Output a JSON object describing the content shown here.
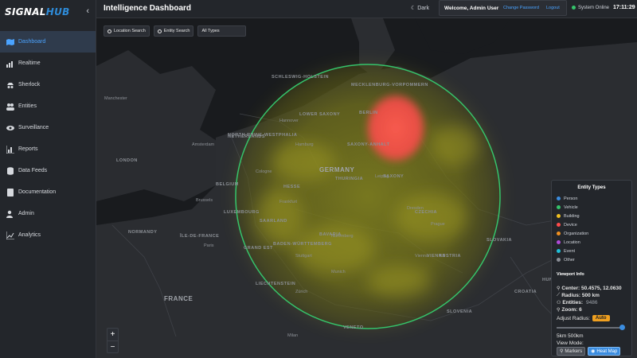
{
  "brand": {
    "name_part1": "SIGNAL",
    "name_part2": "HUB",
    "accent_color": "#2e8bd8",
    "collapse_icon": "chevron-left-icon"
  },
  "sidebar": {
    "items": [
      {
        "label": "Dashboard",
        "icon": "map-icon",
        "active": true
      },
      {
        "label": "Realtime",
        "icon": "signal-icon"
      },
      {
        "label": "Sherlock",
        "icon": "detective-icon"
      },
      {
        "label": "Entities",
        "icon": "users-icon"
      },
      {
        "label": "Surveillance",
        "icon": "eye-icon"
      },
      {
        "label": "Reports",
        "icon": "chart-icon"
      },
      {
        "label": "Data Feeds",
        "icon": "database-icon"
      },
      {
        "label": "Documentation",
        "icon": "book-icon"
      },
      {
        "label": "Admin",
        "icon": "user-cog-icon"
      },
      {
        "label": "Analytics",
        "icon": "line-chart-icon"
      }
    ]
  },
  "header": {
    "title": "Intelligence Dashboard",
    "theme_label": "Dark",
    "welcome": "Welcome, Admin User",
    "change_password": "Change Password",
    "logout": "Logout",
    "status": "System Online",
    "time": "17:11:29"
  },
  "map": {
    "location_search": "Location Search",
    "entity_search": "Entity Search",
    "type_filter": "All Types",
    "zoom_in": "+",
    "zoom_out": "−",
    "labels": [
      "LONDON",
      "BELGIUM",
      "LUXEMBOURG",
      "GERMANY",
      "HESSE",
      "THURINGIA",
      "SAXONY",
      "BAVARIA",
      "CZECHIA",
      "AUSTRIA",
      "SLOVAKIA",
      "LOWER SAXONY",
      "SAXONY-ANHALT",
      "MECKLENBURG-VORPOMMERN",
      "SCHLESWIG-HOLSTEIN",
      "NORTH RHINE-WESTPHALIA",
      "SAARLAND",
      "BADEN-WÜRTTEMBERG",
      "LIECHTENSTEIN",
      "NETHERLANDS",
      "NORMANDY",
      "ÎLE-DE-FRANCE",
      "GRAND EST",
      "FRANCE",
      "VENETO",
      "SLOVENIA",
      "CROATIA",
      "HUNGARY",
      "VIENNA",
      "BERLIN",
      "Hamburg",
      "Hannover",
      "Leipzig",
      "Dresden",
      "Nuremberg",
      "Munich",
      "Vienna",
      "Prague",
      "Paris",
      "Brussels",
      "Amsterdam",
      "Frankfurt",
      "Cologne",
      "Stuttgart",
      "Zürich",
      "Milan",
      "Manchester"
    ],
    "heat": {
      "circle_color": "#35c46b",
      "glow_color": "#c9c21f",
      "hotspot_color": "#ff4b4b"
    }
  },
  "panel": {
    "title": "Entity Types",
    "legend": [
      {
        "label": "Person",
        "color": "#3b8de0"
      },
      {
        "label": "Vehicle",
        "color": "#35c46b"
      },
      {
        "label": "Building",
        "color": "#f0c020"
      },
      {
        "label": "Device",
        "color": "#ff4b4b"
      },
      {
        "label": "Organization",
        "color": "#f09020"
      },
      {
        "label": "Location",
        "color": "#b04bd8"
      },
      {
        "label": "Event",
        "color": "#20c0d8"
      },
      {
        "label": "Other",
        "color": "#8a8e96"
      }
    ],
    "viewport_title": "Viewport Info",
    "center": "Center: 50.4575, 12.0630",
    "radius": "Radius: 500 km",
    "entities_label": "Entities:",
    "entities_value": "9486",
    "zoom": "Zoom: 6",
    "adjust_label": "Adjust Radius:",
    "auto_label": "Auto",
    "radius_fraction": 0.98,
    "slider_label": "5km 500km",
    "view_mode_label": "View Mode:",
    "markers_label": "Markers",
    "heatmap_label": "Heat Map"
  }
}
